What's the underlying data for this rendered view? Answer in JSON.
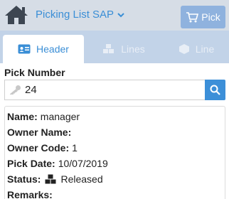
{
  "app": {
    "title": "Picking List SAP",
    "pick_label": "Pick"
  },
  "tabs": [
    {
      "label": "Header",
      "icon": "id-card-icon",
      "active": true
    },
    {
      "label": "Lines",
      "icon": "cubes-icon",
      "active": false
    },
    {
      "label": "Line",
      "icon": "cube-icon",
      "active": false
    }
  ],
  "pick_number": {
    "label": "Pick Number",
    "value": "24"
  },
  "details": {
    "name_label": "Name:",
    "name_value": "manager",
    "owner_name_label": "Owner Name:",
    "owner_name_value": "",
    "owner_code_label": "Owner Code:",
    "owner_code_value": "1",
    "pick_date_label": "Pick Date:",
    "pick_date_value": "10/07/2019",
    "status_label": "Status:",
    "status_value": "Released",
    "remarks_label": "Remarks:",
    "remarks_value": ""
  },
  "colors": {
    "accent": "#3a8ed6",
    "topbar": "#d6dde6",
    "tabstrip": "#c2d3e8",
    "pick_button": "#8fb2de"
  }
}
